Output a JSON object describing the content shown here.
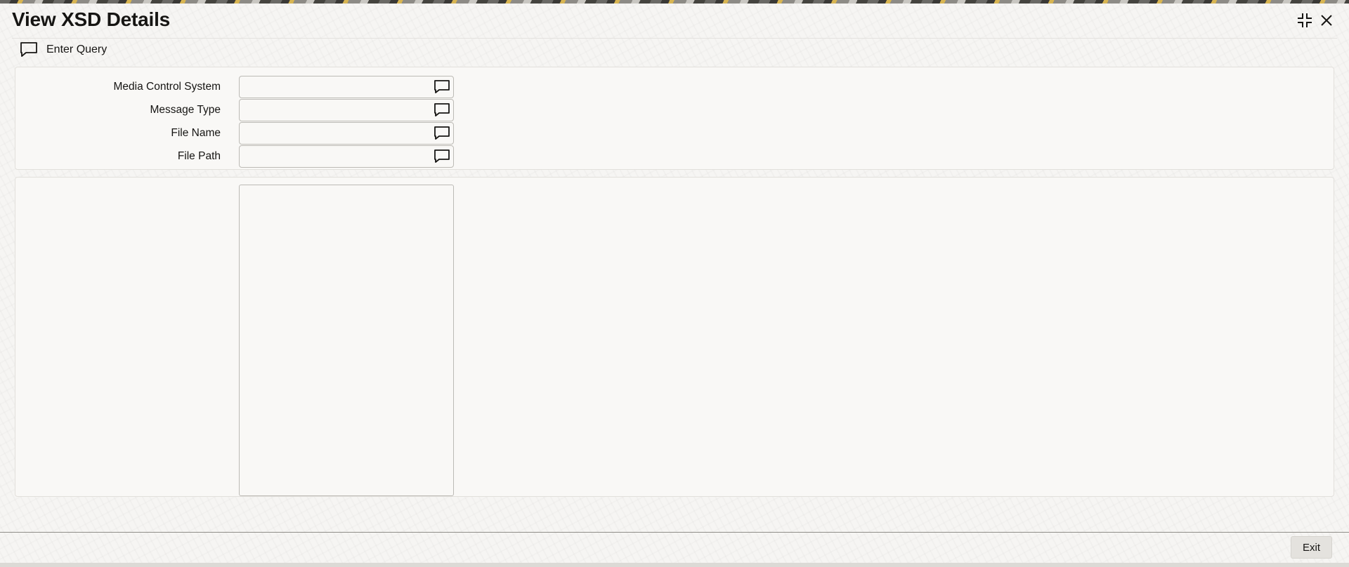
{
  "window": {
    "title": "View XSD Details"
  },
  "toolbar": {
    "enter_query_label": "Enter Query"
  },
  "fields": [
    {
      "label": "Media Control System",
      "value": ""
    },
    {
      "label": "Message Type",
      "value": ""
    },
    {
      "label": "File Name",
      "value": ""
    },
    {
      "label": "File Path",
      "value": ""
    }
  ],
  "xsd_view": {
    "content": ""
  },
  "footer": {
    "exit_label": "Exit"
  },
  "icons": {
    "window_controls": [
      "minimize-icon",
      "close-icon"
    ],
    "toolbar": "speech-bubble-icon",
    "field_lookup": "speech-bubble-icon"
  },
  "colors": {
    "text": "#161513",
    "field_border": "#bcbab5",
    "panel_background": "#f9f8f6",
    "exit_button": "#e4e2de"
  }
}
